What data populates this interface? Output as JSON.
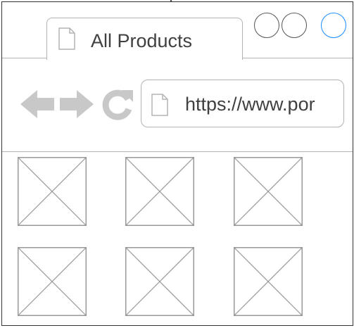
{
  "tab": {
    "label": "All Products",
    "icon": "page-icon"
  },
  "window_controls": [
    {
      "name": "minimize",
      "color": "#555555"
    },
    {
      "name": "restore",
      "color": "#555555"
    },
    {
      "name": "maximize",
      "color": "#1a8cff"
    }
  ],
  "toolbar": {
    "back_icon": "arrow-left-icon",
    "forward_icon": "arrow-right-icon",
    "reload_icon": "reload-icon"
  },
  "address_bar": {
    "value": "https://www.por",
    "icon": "page-icon"
  },
  "products": [
    {
      "icon": "image-placeholder-icon"
    },
    {
      "icon": "image-placeholder-icon"
    },
    {
      "icon": "image-placeholder-icon"
    },
    {
      "icon": "image-placeholder-icon"
    },
    {
      "icon": "image-placeholder-icon"
    },
    {
      "icon": "image-placeholder-icon"
    }
  ],
  "colors": {
    "border": "#b3b3b3",
    "icon_gray": "#c8c8c8",
    "text": "#404040",
    "accent": "#1a8cff"
  }
}
